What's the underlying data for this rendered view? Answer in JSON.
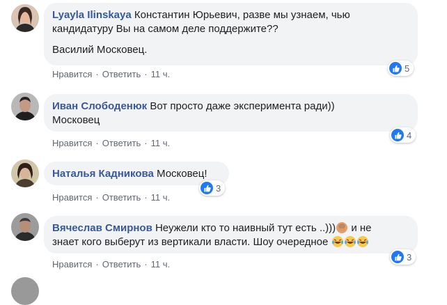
{
  "comments": [
    {
      "author": "Lyayla Ilinskaya",
      "text": "Константин Юрьевич, разве мы узнаем, чью кандидатуру Вы на самом деле поддержите??",
      "text2": "Василий Московец.",
      "like": "Нравится",
      "reply": "Ответить",
      "time": "11 ч.",
      "reactions": "5",
      "avatar_bg": "#c9a590"
    },
    {
      "author": "Иван Слободенюк",
      "text": "Вот просто даже эксперимента ради))",
      "text2": "Московец",
      "like": "Нравится",
      "reply": "Ответить",
      "time": "11 ч.",
      "reactions": "4",
      "avatar_bg": "#8a8a8a"
    },
    {
      "author": "Наталья Кадникова",
      "text": "Московец!",
      "like": "Нравится",
      "reply": "Ответить",
      "time": "11 ч.",
      "reactions": "3",
      "avatar_bg": "#9a8c70"
    },
    {
      "author": "Вячеслав Смирнов",
      "text": "Неужели кто то наивный тут есть ..)))",
      "text_mid": " и не",
      "text2": "знает кого выберут из вертикали власти. Шоу очередное",
      "like": "Нравится",
      "reply": "Ответить",
      "time": "11 ч.",
      "reactions": "3",
      "avatar_bg": "#6b6b6b"
    }
  ],
  "colors": {
    "author": "#385898",
    "bubble": "#f2f3f5",
    "meta": "#606770",
    "like": "#2078f4"
  },
  "icons": [
    "like-icon",
    "facepalm-emoji-icon",
    "laughing-tears-emoji-icon"
  ]
}
